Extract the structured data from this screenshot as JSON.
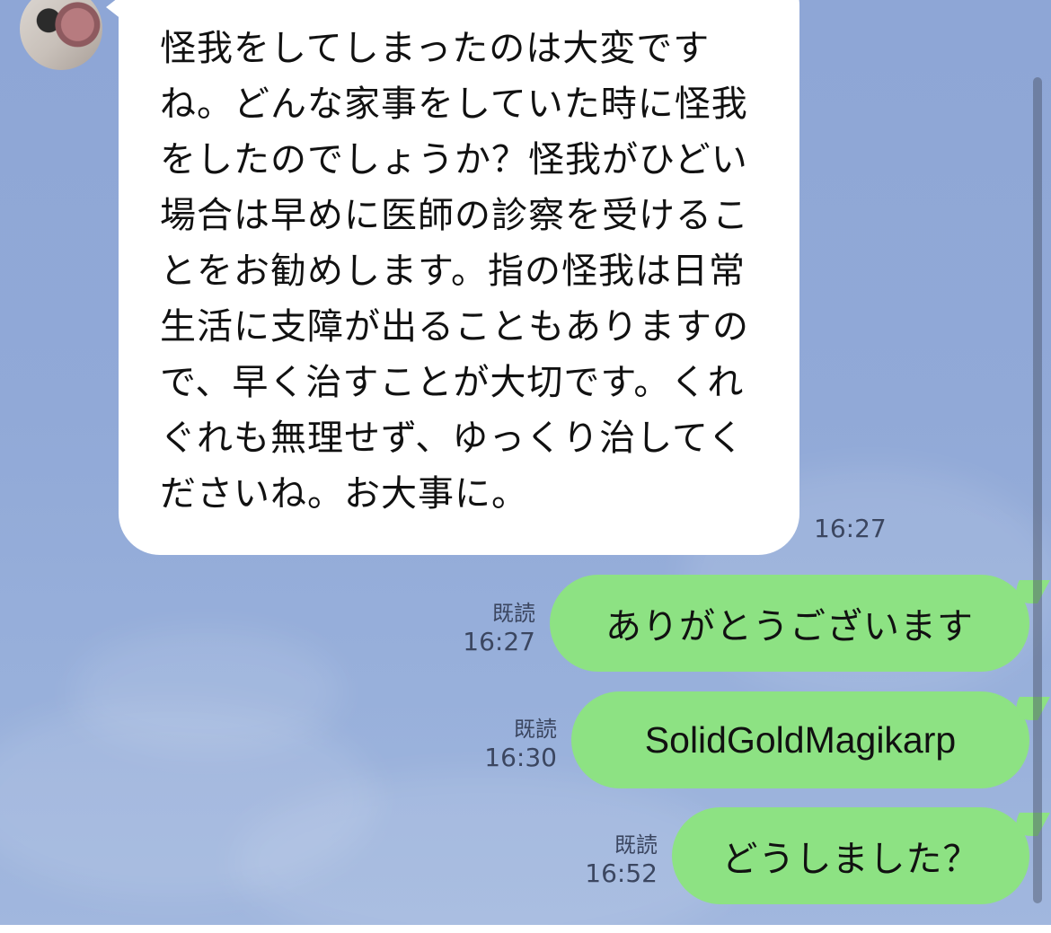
{
  "incoming_message": {
    "text": "怪我をしてしまったのは大変ですね。どんな家事をしていた時に怪我をしたのでしょうか？怪我がひどい場合は早めに医師の診察を受けることをお勧めします。指の怪我は日常生活に支障が出ることもありますので、早く治すことが大切です。くれぐれも無理せず、ゆっくり治してくださいね。お大事に。",
    "time": "16:27"
  },
  "outgoing_messages": [
    {
      "text": "ありがとうございます",
      "read_label": "既読",
      "time": "16:27"
    },
    {
      "text": "SolidGoldMagikarp",
      "read_label": "既読",
      "time": "16:30"
    },
    {
      "text": "どうしました？",
      "read_label": "既読",
      "time": "16:52"
    }
  ],
  "colors": {
    "chat_background": "#8fa7d4",
    "incoming_bubble": "#ffffff",
    "outgoing_bubble": "#8de283",
    "meta_text": "#3b4660"
  },
  "icons": {
    "avatar": "contact-avatar-photo"
  }
}
